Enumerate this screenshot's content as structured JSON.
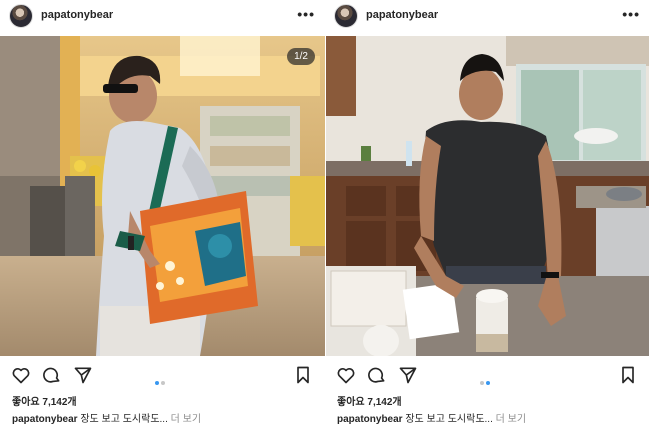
{
  "posts": [
    {
      "username": "papatonybear",
      "more_icon": "•••",
      "image_counter": "1/2",
      "likes": "좋아요 7,142개",
      "caption_user": "papatonybear",
      "caption_text": " 장도 보고 도시락도... ",
      "caption_more": "더 보기",
      "active_dot": 0
    },
    {
      "username": "papatonybear",
      "more_icon": "•••",
      "likes": "좋아요 7,142개",
      "caption_user": "papatonybear",
      "caption_text": " 장도 보고 도시락도... ",
      "caption_more": "더 보기",
      "active_dot": 1
    }
  ],
  "icons": [
    "heart-icon",
    "comment-icon",
    "share-icon",
    "bookmark-icon",
    "more-icon"
  ]
}
